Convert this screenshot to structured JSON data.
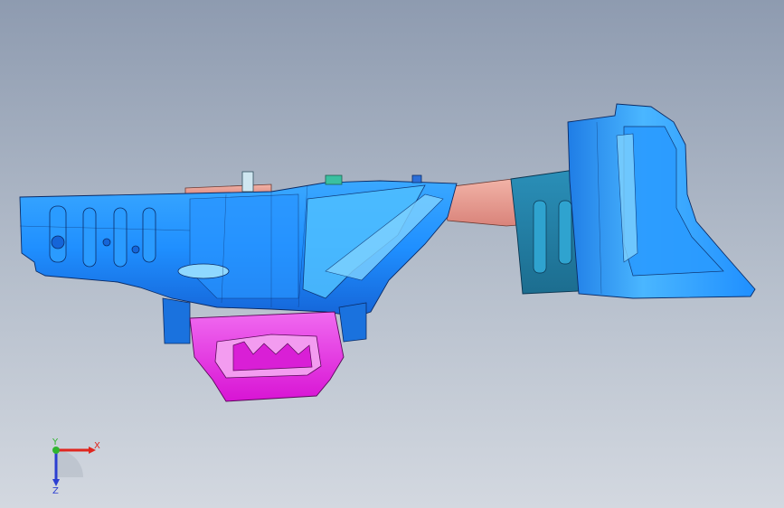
{
  "viewport": {
    "background_top": "#8e9bb0",
    "background_bottom": "#d3d8e0"
  },
  "model": {
    "colors": {
      "main_body": "#1f8fff",
      "highlight": "#7fd2ff",
      "spare_tire_well": "#e520e0",
      "rail": "#e79a8e",
      "outline": "#0a2b66"
    }
  },
  "triad": {
    "x_label": "X",
    "y_label": "Y",
    "z_label": "Z",
    "x_color": "#e0261e",
    "y_color": "#2fb52f",
    "z_color": "#2c3fd1"
  }
}
